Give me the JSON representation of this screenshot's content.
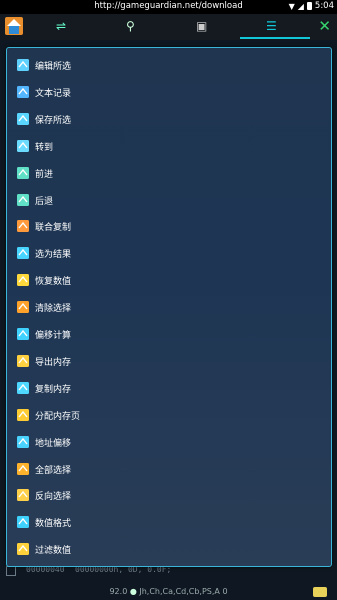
{
  "status_bar": {
    "url": "http://gameguardian.net/download",
    "time": "5:04"
  },
  "menu": {
    "items": [
      {
        "label": "编辑所选",
        "icon": "edit-selected-icon",
        "color": "#5fd1ff"
      },
      {
        "label": "文本记录",
        "icon": "text-log-icon",
        "color": "#53b6ff"
      },
      {
        "label": "保存所选",
        "icon": "save-selected-icon",
        "color": "#5ad5ff"
      },
      {
        "label": "转到",
        "icon": "goto-arrow-icon",
        "color": "#6bdcff"
      },
      {
        "label": "前进",
        "icon": "forward-arrow-icon",
        "color": "#5fe0c7"
      },
      {
        "label": "后退",
        "icon": "back-arrow-icon",
        "color": "#5fe0c7"
      },
      {
        "label": "联合复制",
        "icon": "joint-copy-icon",
        "color": "#ff9a3c"
      },
      {
        "label": "选为结果",
        "icon": "select-as-result-icon",
        "color": "#47d4ff"
      },
      {
        "label": "恢复数值",
        "icon": "restore-values-icon",
        "color": "#ffd93c"
      },
      {
        "label": "清除选择",
        "icon": "clear-selection-icon",
        "color": "#ffa22c"
      },
      {
        "label": "偏移计算",
        "icon": "offset-calc-icon",
        "color": "#3fd2ff"
      },
      {
        "label": "导出内存",
        "icon": "export-memory-icon",
        "color": "#ffd040"
      },
      {
        "label": "复制内存",
        "icon": "copy-memory-icon",
        "color": "#4fd8ff"
      },
      {
        "label": "分配内存页",
        "icon": "allocate-page-icon",
        "color": "#ffcc33"
      },
      {
        "label": "地址偏移",
        "icon": "address-offset-icon",
        "color": "#4bd3ff"
      },
      {
        "label": "全部选择",
        "icon": "select-all-icon",
        "color": "#ffb22c"
      },
      {
        "label": "反向选择",
        "icon": "invert-selection-icon",
        "color": "#ffd04a"
      },
      {
        "label": "数值格式",
        "icon": "value-format-icon",
        "color": "#3fd2ff"
      },
      {
        "label": "过滤数值",
        "icon": "filter-values-icon",
        "color": "#ffd23c"
      }
    ]
  },
  "background": {
    "rows": [
      {
        "addr": "00000040",
        "val": "00000000h, 0D, 0.0F;"
      }
    ]
  },
  "bottom_status": {
    "text_a": "92.0",
    "text_b": "Jh,Ch,Ca,Cd,Cb,PS,A 0"
  }
}
